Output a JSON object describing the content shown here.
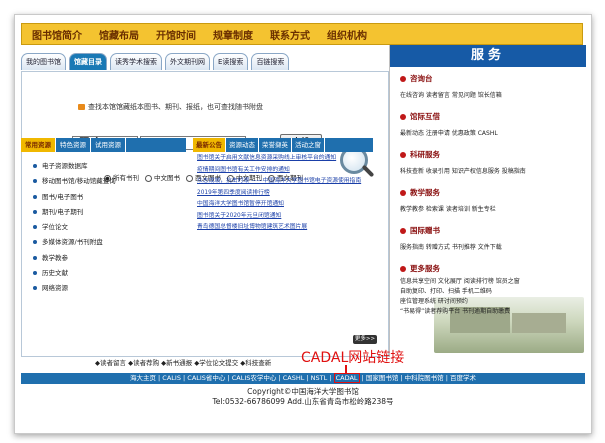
{
  "topnav": [
    "图书馆简介",
    "馆藏布局",
    "开馆时间",
    "规章制度",
    "联系方式",
    "组织机构"
  ],
  "tabs": [
    "我的图书馆",
    "馆藏目录",
    "读秀学术搜索",
    "外文期刊网",
    "E读搜索",
    "百链搜索"
  ],
  "search": {
    "hint": "查找本馆馆藏纸本图书、期刊、报纸，也可查找随书附盘",
    "field": "题  名",
    "button": "查找"
  },
  "radios": [
    "所有书刊",
    "中文图书",
    "西文图书",
    "中文期刊",
    "西文期刊"
  ],
  "left_tabs": [
    "常用资源",
    "特色资源",
    "试用资源"
  ],
  "left_items": [
    "电子资源数据库",
    "移动图书馆/移动馆藏查询",
    "图书/电子图书",
    "期刊/电子期刊",
    "学位论文",
    "多媒体资源/书刊附盘",
    "教学教参",
    "历史文献",
    "网络资源"
  ],
  "news_tabs": [
    "最新公告",
    "资源动态",
    "荣誉撷英",
    "活动之窗"
  ],
  "news": [
    "图书馆关于启用文献信息资源采购线上审核平台的通知",
    "疫情期间图书馆有关工作安排的通知",
    "众志成城，抗击时艰 ——中国海洋大学图书馆电子资源使用指南",
    "2019年第四季度阅读排行榜",
    "中国海洋大学图书馆暂停开馆通知",
    "图书馆关于2020年元旦闭馆通知",
    "青岛德国总督楼旧址博物馆建筑艺术图片展"
  ],
  "more_label": "更多>>",
  "right": {
    "header": "服务",
    "sections": [
      {
        "title": "咨询台",
        "links": "在线咨询  读者留言  常见问题  馆长信箱"
      },
      {
        "title": "馆际互借",
        "links": "最新动态  注册申请  优惠政策  CASHL"
      },
      {
        "title": "科研服务",
        "links": "科技查新  收录引用  知识产权信息服务  投稿指南"
      },
      {
        "title": "教学服务",
        "links": "教学教参  检索课  读者培训  新生专栏"
      },
      {
        "title": "国际赠书",
        "links": "服务指南  转赠方式  书刊推荐  文件下载"
      },
      {
        "title": "更多服务",
        "links": "信息共享空间  文化展厅  阅读排行榜  馆员之窗\n自助复印、打印、扫描  手机二维码\n座位管理系统  研讨间预约\n“书易得”读者荐购平台    书刊逾期自助缴费"
      }
    ]
  },
  "bottom_links": "◆读者留言  ◆读者荐购  ◆新书通报  ◆学位论文提交  ◆科技查新",
  "linkbar": {
    "left": "海大主页 | CALIS | CALIS省中心 | CALIS农学中心 | CASHL | NSTL | ",
    "cadal": "CADAL",
    "right": " | 国家图书馆 | 中科院图书馆 | 百度学术"
  },
  "annotation": "CADAL网站链接",
  "copyright": [
    "Copyright©中国海洋大学图书馆",
    "Tel:0532-66786099 Add.山东省青岛市松岭路238号"
  ]
}
